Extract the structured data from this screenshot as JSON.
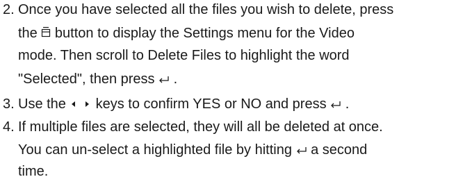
{
  "steps": [
    {
      "number": "2.",
      "lines": [
        {
          "text": "Once you have selected all the files you wish to delete, press"
        },
        {
          "before": "the ",
          "icon": "menu-icon",
          "after": " button to display the Settings menu for the Video"
        },
        {
          "text": "mode.  Then scroll to Delete Files to highlight the word"
        },
        {
          "before": "\"Selected\", then press ",
          "icon": "enter-icon",
          "after": "."
        }
      ]
    },
    {
      "number": "3.",
      "lines": [
        {
          "before": "Use the ",
          "icon": "left-arrow-icon",
          "mid": "",
          "icon2": "right-arrow-icon",
          "after": " keys to confirm YES or NO and press ",
          "icon3": "enter-icon",
          "tail": "."
        }
      ]
    },
    {
      "number": "4.",
      "lines": [
        {
          "text": "If multiple files are selected, they will all be deleted at once."
        },
        {
          "before": "You can un-select a highlighted file by hitting ",
          "icon": "enter-icon",
          "after": " a second"
        },
        {
          "text": "time."
        }
      ]
    }
  ]
}
